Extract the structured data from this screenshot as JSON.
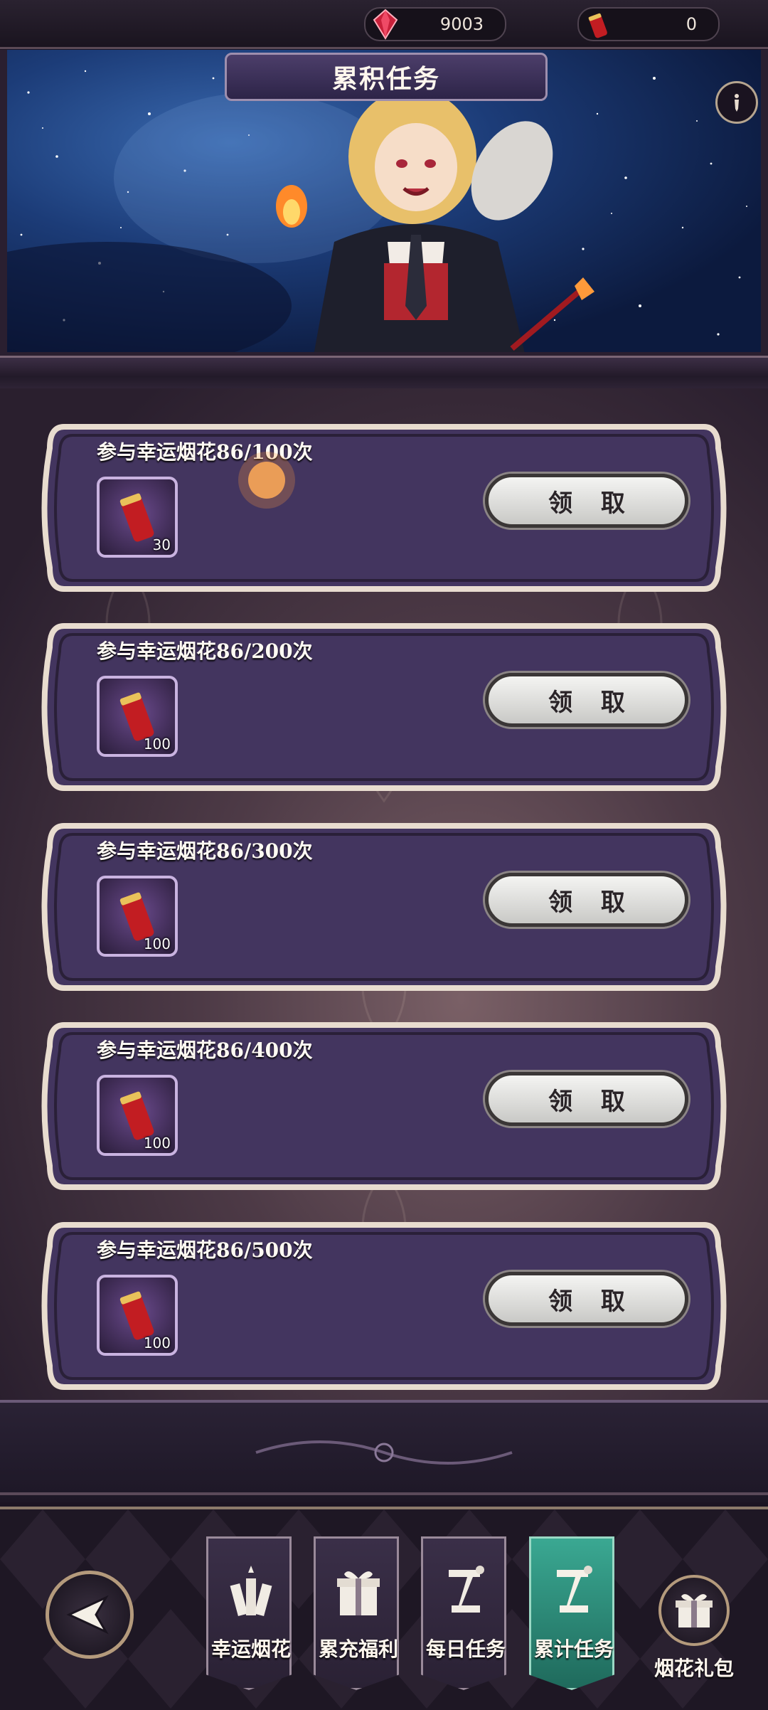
{
  "currencies": [
    {
      "icon": "red-gem-icon",
      "value": "9003"
    },
    {
      "icon": "firework-rocket-icon",
      "value": "0"
    }
  ],
  "header": {
    "title": "累积任务",
    "info_icon": "info-icon"
  },
  "tasks": [
    {
      "title": "参与幸运烟花86/100次",
      "reward_icon": "firework-rocket-icon",
      "reward_count": "30",
      "button_label": "领 取"
    },
    {
      "title": "参与幸运烟花86/200次",
      "reward_icon": "firework-rocket-icon",
      "reward_count": "100",
      "button_label": "领 取"
    },
    {
      "title": "参与幸运烟花86/300次",
      "reward_icon": "firework-rocket-icon",
      "reward_count": "100",
      "button_label": "领 取"
    },
    {
      "title": "参与幸运烟花86/400次",
      "reward_icon": "firework-rocket-icon",
      "reward_count": "100",
      "button_label": "领 取"
    },
    {
      "title": "参与幸运烟花86/500次",
      "reward_icon": "firework-rocket-icon",
      "reward_count": "100",
      "button_label": "领 取"
    }
  ],
  "nav": {
    "back_icon": "back-arrow-icon",
    "tabs": [
      {
        "label": "幸运烟花",
        "icon": "fireworks-icon",
        "active": false
      },
      {
        "label": "累充福利",
        "icon": "gift-box-icon",
        "active": false
      },
      {
        "label": "每日任务",
        "icon": "scroll-icon",
        "active": false
      },
      {
        "label": "累计任务",
        "icon": "scroll-icon",
        "active": true
      }
    ],
    "gift": {
      "label": "烟花礼包",
      "icon": "gift-box-icon"
    }
  },
  "colors": {
    "accent_active": "#2f8f7c",
    "panel_purple": "#4a3a6a",
    "frame_light": "#e8dccf"
  }
}
